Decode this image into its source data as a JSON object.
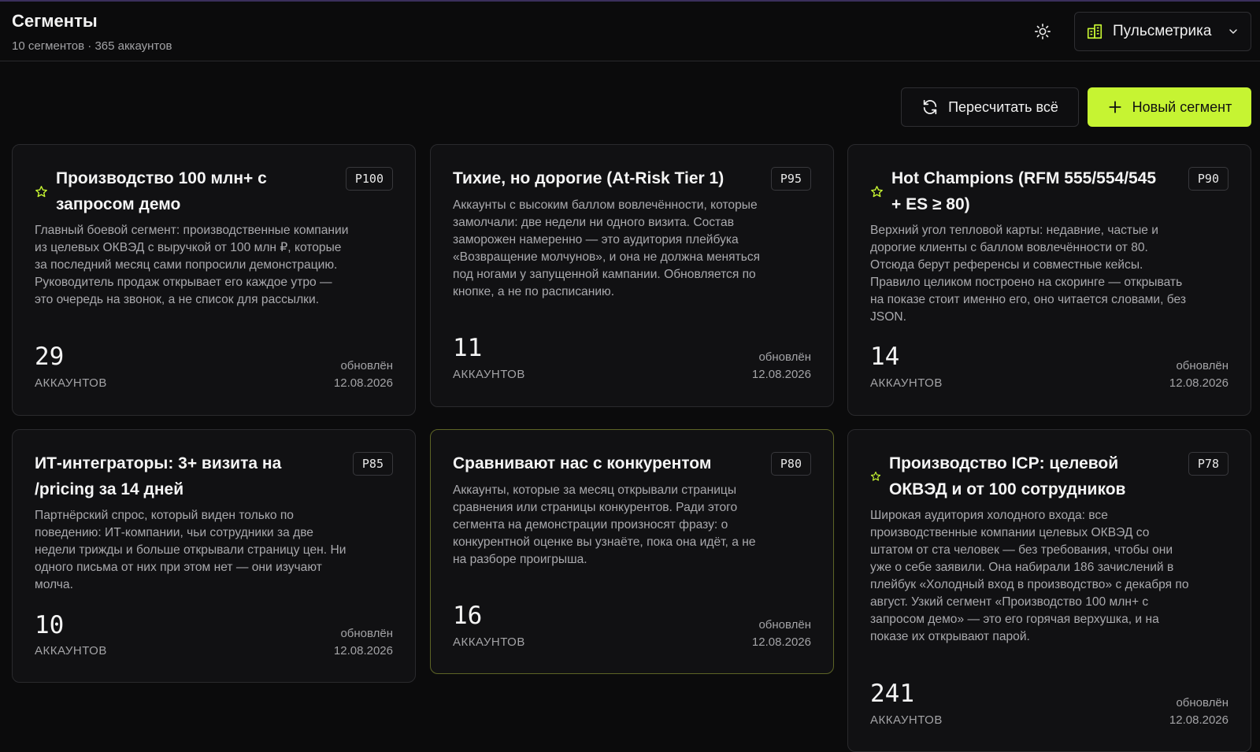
{
  "header": {
    "title": "Сегменты",
    "subtitle": "10 сегментов · 365 аккаунтов",
    "org": "Пульсметрика"
  },
  "actions": {
    "recalc": "Пересчитать всё",
    "new_segment": "Новый сегмент"
  },
  "colors": {
    "accent": "#c6f432",
    "background": "#0b0b0c",
    "card": "#111113"
  },
  "cards": [
    {
      "starred": true,
      "title": "Производство 100 млн+ с запросом демо",
      "priority": "P100",
      "description": "Главный боевой сегмент: производственные компании из целевых ОКВЭД с выручкой от 100 млн ₽, которые за последний месяц сами попросили демонстрацию. Руководитель продаж открывает его каждое утро — это очередь на звонок, а не список для рассылки.",
      "count": "29",
      "count_label": "АККАУНТОВ",
      "updated_label": "обновлён",
      "updated_date": "12.08.2026"
    },
    {
      "starred": false,
      "title": "Тихие, но дорогие (At-Risk Tier 1)",
      "priority": "P95",
      "description": "Аккаунты с высоким баллом вовлечённости, которые замолчали: две недели ни одного визита. Состав заморожен намеренно — это аудитория плейбука «Возвращение молчунов», и она не должна меняться под ногами у запущенной кампании. Обновляется по кнопке, а не по расписанию.",
      "count": "11",
      "count_label": "АККАУНТОВ",
      "updated_label": "обновлён",
      "updated_date": "12.08.2026"
    },
    {
      "starred": true,
      "title": "Hot Champions (RFM 555/554/545 + ES ≥ 80)",
      "priority": "P90",
      "description": "Верхний угол тепловой карты: недавние, частые и дорогие клиенты с баллом вовлечённости от 80. Отсюда берут референсы и совместные кейсы. Правило целиком построено на скоринге — открывать на показе стоит именно его, оно читается словами, без JSON.",
      "count": "14",
      "count_label": "АККАУНТОВ",
      "updated_label": "обновлён",
      "updated_date": "12.08.2026"
    },
    {
      "starred": false,
      "title": "ИТ-интеграторы: 3+ визита на /pricing за 14 дней",
      "priority": "P85",
      "description": "Партнёрский спрос, который виден только по поведению: ИТ-компании, чьи сотрудники за две недели трижды и больше открывали страницу цен. Ни одного письма от них при этом нет — они изучают молча.",
      "count": "10",
      "count_label": "АККАУНТОВ",
      "updated_label": "обновлён",
      "updated_date": "12.08.2026"
    },
    {
      "starred": false,
      "title": "Сравнивают нас с конкурентом",
      "priority": "P80",
      "description": "Аккаунты, которые за месяц открывали страницы сравнения или страницы конкурентов. Ради этого сегмента на демонстрации произносят фразу: о конкурентной оценке вы узнаёте, пока она идёт, а не на разборе проигрыша.",
      "count": "16",
      "count_label": "АККАУНТОВ",
      "updated_label": "обновлён",
      "updated_date": "12.08.2026"
    },
    {
      "starred": true,
      "title": "Производство ICP: целевой ОКВЭД и от 100 сотрудников",
      "priority": "P78",
      "description": "Широкая аудитория холодного входа: все производственные компании целевых ОКВЭД со штатом от ста человек — без требования, чтобы они уже о себе заявили. Она набирали 186 зачислений в плейбук «Холодный вход в производство» с декабря по август. Узкий сегмент «Производство 100 млн+ с запросом демо» — это его горячая верхушка, и на показе их открывают парой.",
      "count": "241",
      "count_label": "АККАУНТОВ",
      "updated_label": "обновлён",
      "updated_date": "12.08.2026"
    }
  ]
}
